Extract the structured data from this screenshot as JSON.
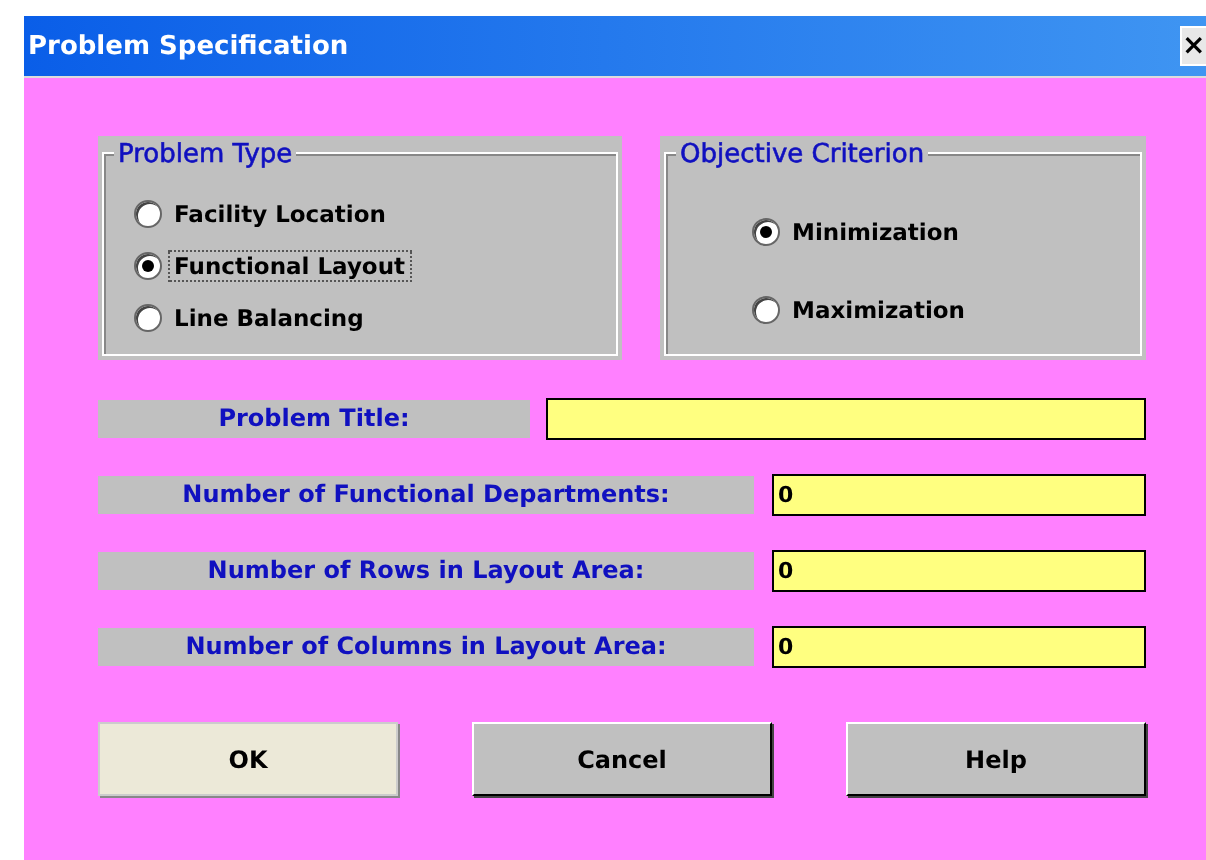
{
  "window": {
    "title": "Problem Specification",
    "close": "×"
  },
  "groups": [
    {
      "title": "Problem Type",
      "options": [
        {
          "label": "Facility Location",
          "selected": false
        },
        {
          "label": "Functional Layout",
          "selected": true
        },
        {
          "label": "Line Balancing",
          "selected": false
        }
      ]
    },
    {
      "title": "Objective Criterion",
      "options": [
        {
          "label": "Minimization",
          "selected": true
        },
        {
          "label": "Maximization",
          "selected": false
        }
      ]
    }
  ],
  "fields": [
    {
      "label": "Problem Title:",
      "kind": "wide"
    },
    {
      "label": "Number of Functional Departments:",
      "value": "0",
      "kind": "narrow"
    },
    {
      "label": "Number of Rows in Layout Area:",
      "value": "0",
      "kind": "narrow"
    },
    {
      "label": "Number of Columns in Layout Area:",
      "value": "0",
      "kind": "narrow"
    }
  ],
  "buttons": [
    {
      "label": "OK",
      "default": true
    },
    {
      "label": "Cancel",
      "default": false
    },
    {
      "label": "Help",
      "default": false
    }
  ]
}
